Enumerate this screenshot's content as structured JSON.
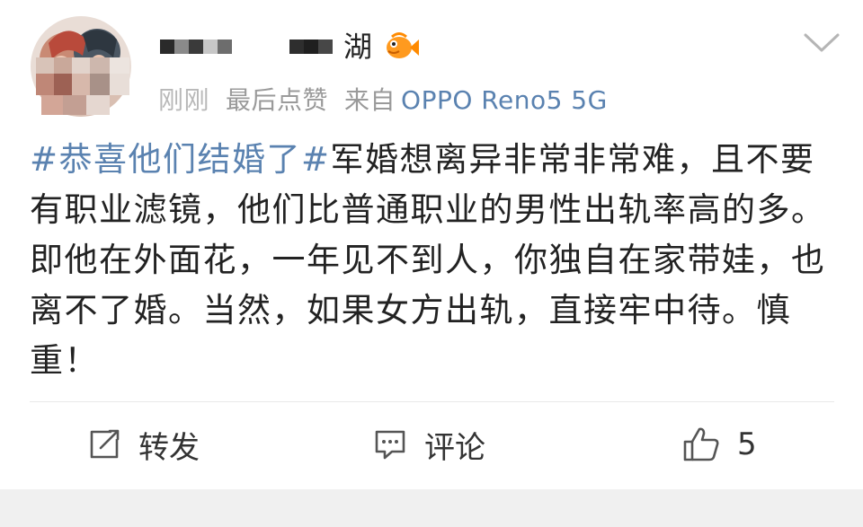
{
  "post": {
    "username_visible": "湖",
    "meta": {
      "time": "刚刚",
      "last_like": "最后点赞",
      "source_prefix": "来自",
      "source_device": "OPPO Reno5 5G"
    },
    "hashtag": "#恭喜他们结婚了#",
    "text": "军婚想离异非常非常难，且不要有职业滤镜，他们比普通职业的男性出轨率高的多。即他在外面花，一年见不到人，你独自在家带娃，也离不了婚。当然，如果女方出轨，直接牢中待。慎重！",
    "actions": {
      "repost_label": "转发",
      "comment_label": "评论",
      "like_count": "5"
    }
  },
  "colors": {
    "link_blue": "#5a82b0",
    "meta_gray": "#9a9a9a",
    "text": "#222222"
  },
  "icons": [
    "avatar",
    "fish-badge-icon",
    "chevron-down-icon",
    "repost-icon",
    "comment-icon",
    "thumbs-up-icon"
  ]
}
